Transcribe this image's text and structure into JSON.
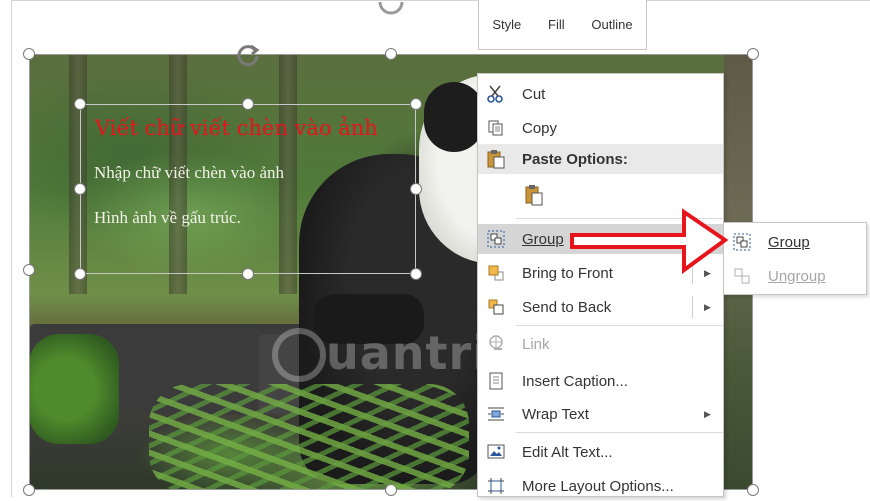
{
  "slide": {
    "title_text": "Viết chữ viết chèn vào ảnh",
    "line1": "Nhập chữ viết chèn vào ảnh",
    "line2": "Hình ảnh về gấu trúc.",
    "watermark": "uantrimang"
  },
  "mini_toolbar": {
    "style": "Style",
    "fill": "Fill",
    "outline": "Outline"
  },
  "context_menu": {
    "cut": "Cut",
    "copy": "Copy",
    "paste_options": "Paste Options:",
    "group": "Group",
    "bring_to_front": "Bring to Front",
    "send_to_back": "Send to Back",
    "link": "Link",
    "insert_caption": "Insert Caption...",
    "wrap_text": "Wrap Text",
    "edit_alt_text": "Edit Alt Text...",
    "more_layout": "More Layout Options..."
  },
  "submenu": {
    "group": "Group",
    "ungroup": "Ungroup"
  },
  "colors": {
    "title_red": "#e8141b",
    "highlight": "#d5d5d5",
    "callout_red": "#e8141b"
  }
}
